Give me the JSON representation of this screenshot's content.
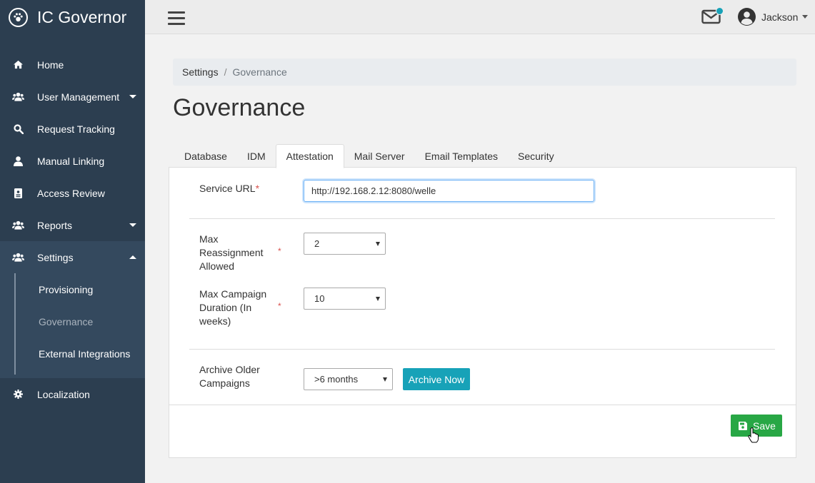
{
  "brand": {
    "title": "IC Governor",
    "logo_icon": "paw-icon"
  },
  "sidebar": {
    "items": [
      {
        "label": "Home",
        "icon": "home-icon"
      },
      {
        "label": "User Management",
        "icon": "users-icon"
      },
      {
        "label": "Request Tracking",
        "icon": "search-icon"
      },
      {
        "label": "Manual Linking",
        "icon": "user-icon"
      },
      {
        "label": "Access Review",
        "icon": "id-card-icon"
      },
      {
        "label": "Reports",
        "icon": "users-icon"
      },
      {
        "label": "Settings",
        "icon": "users-icon"
      },
      {
        "label": "Localization",
        "icon": "gear-icon"
      }
    ],
    "settings_sub": [
      {
        "label": "Provisioning"
      },
      {
        "label": "Governance"
      },
      {
        "label": "External Integrations"
      }
    ]
  },
  "topbar": {
    "user_name": "Jackson",
    "notification_color": "#17a2b8"
  },
  "breadcrumb": {
    "parent": "Settings",
    "separator": "/",
    "current": "Governance"
  },
  "page": {
    "title": "Governance"
  },
  "tabs": [
    {
      "label": "Database"
    },
    {
      "label": "IDM"
    },
    {
      "label": "Attestation",
      "active": true
    },
    {
      "label": "Mail Server"
    },
    {
      "label": "Email Templates"
    },
    {
      "label": "Security"
    }
  ],
  "form": {
    "service_url": {
      "label": "Service URL",
      "required": "*",
      "value": "http://192.168.2.12:8080/welle"
    },
    "max_reassignment": {
      "label_lines": [
        "Max",
        "Reassignment",
        "Allowed"
      ],
      "required": "*",
      "value": "2"
    },
    "max_campaign": {
      "label_lines": [
        "Max Campaign",
        "Duration (In",
        "weeks)"
      ],
      "required": "*",
      "value": "10"
    },
    "archive": {
      "label_lines": [
        "Archive Older",
        "Campaigns"
      ],
      "value": ">6 months",
      "button": "Archive Now"
    },
    "save_label": "Save"
  },
  "colors": {
    "sidebar": "#2c3e50",
    "accent": "#17a2b8",
    "save": "#28a745"
  }
}
